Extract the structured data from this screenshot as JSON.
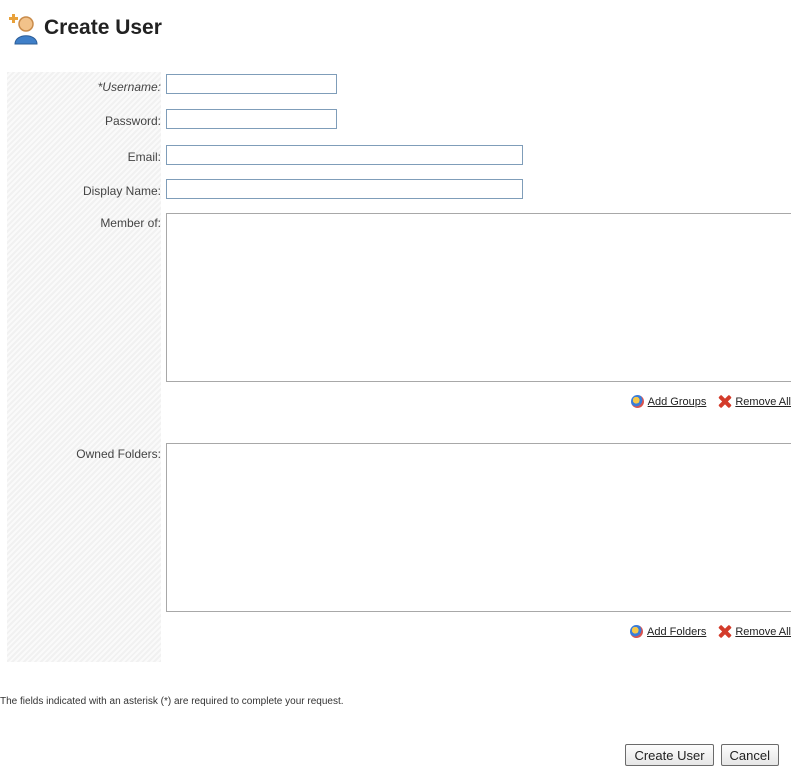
{
  "header": {
    "title": "Create User",
    "icon": "add-user-icon"
  },
  "form": {
    "username_label": "*Username:",
    "username_value": "",
    "password_label": "Password:",
    "password_value": "",
    "email_label": "Email:",
    "email_value": "",
    "display_name_label": "Display Name:",
    "display_name_value": "",
    "member_of_label": "Member of:",
    "owned_folders_label": "Owned Folders:"
  },
  "member_actions": {
    "add_label": "Add Groups",
    "remove_label": "Remove All"
  },
  "folder_actions": {
    "add_label": "Add Folders",
    "remove_label": "Remove All"
  },
  "note": "The fields indicated with an asterisk (*) are required to complete your request.",
  "buttons": {
    "create": "Create User",
    "cancel": "Cancel"
  },
  "colors": {
    "field_border": "#7f9db9",
    "listbox_border": "#a8a8a8"
  }
}
